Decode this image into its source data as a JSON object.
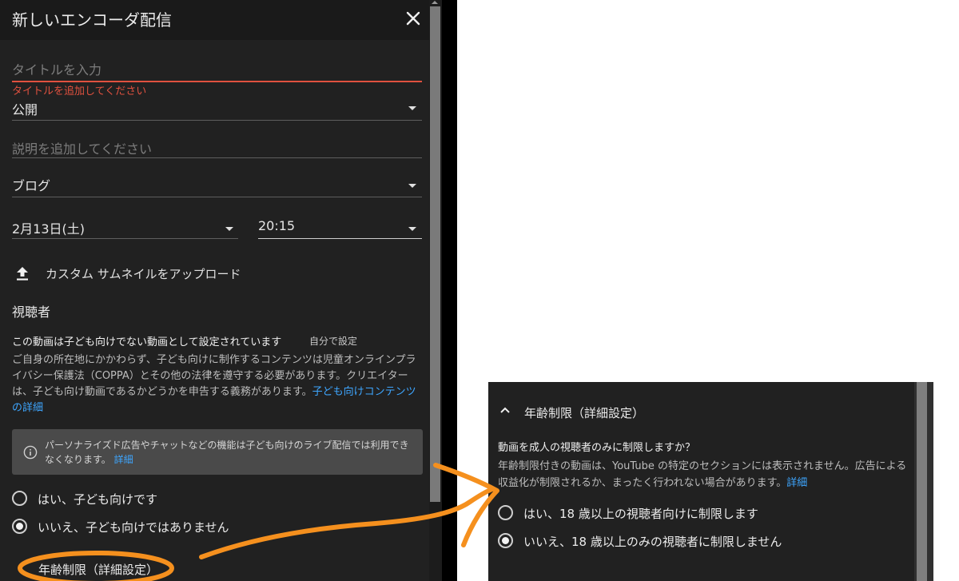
{
  "dialog": {
    "title": "新しいエンコーダ配信",
    "title_placeholder": "タイトルを入力",
    "title_error": "タイトルを追加してください",
    "visibility": "公開",
    "description_placeholder": "説明を追加してください",
    "category": "ブログ",
    "date": "2月13日(土)",
    "time": "20:15",
    "upload_thumbnail": "カスタム サムネイルをアップロード",
    "audience": {
      "title": "視聴者",
      "status": "この動画は子ども向けでない動画として設定されています",
      "source": "自分で設定",
      "coppa_text": "ご自身の所在地にかかわらず、子ども向けに制作するコンテンツは児童オンラインプライバシー保護法（COPPA）とその他の法律を遵守する必要があります。クリエイターは、子ども向け動画であるかどうかを申告する義務があります。",
      "coppa_link": "子ども向けコンテンツの詳細",
      "info_text": "パーソナライズド広告やチャットなどの機能は子ども向けのライブ配信では利用できなくなります。",
      "info_link": "詳細",
      "radio_yes": "はい、子ども向けです",
      "radio_no": "いいえ、子ども向けではありません",
      "selected": "no"
    },
    "age_restriction_summary": "年齢制限（詳細設定）"
  },
  "age_panel": {
    "title": "年齢制限（詳細設定）",
    "question": "動画を成人の視聴者のみに制限しますか？",
    "description": "年齢制限付きの動画は、YouTube の特定のセクションには表示されません。広告による収益化が制限されるか、まったく行われない場合があります。",
    "link": "詳細",
    "radio_yes": "はい、18 歳以上の視聴者向けに制限します",
    "radio_no": "いいえ、18 歳以上のみの視聴者に制限しません",
    "selected": "no"
  },
  "icons": {
    "close": "close-icon",
    "dropdown": "caret-down-icon",
    "upload": "upload-icon",
    "info": "info-icon",
    "collapse": "chevron-up-icon"
  },
  "colors": {
    "background": "#212121",
    "error": "#e0513f",
    "link": "#3ea6ff",
    "annotation": "#f5901e"
  }
}
